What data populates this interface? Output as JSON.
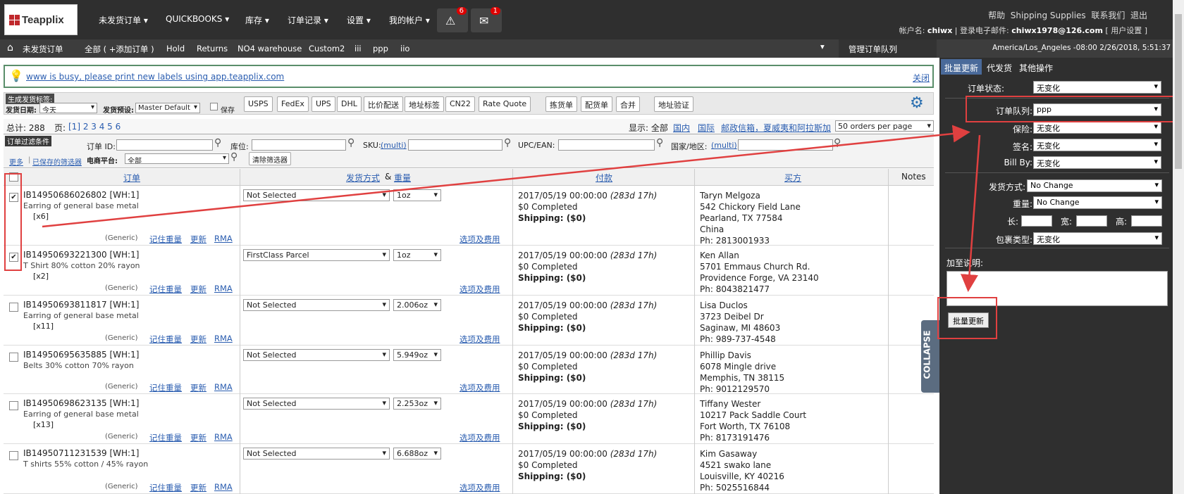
{
  "logo": "Teapplix",
  "topnav": [
    "未发货订单 ▾",
    "QUICKBOOKS ▾",
    "库存 ▾",
    "订单记录 ▾",
    "设置 ▾",
    "我的帐户 ▾"
  ],
  "alerts": {
    "warning_count": "6",
    "message_count": "1"
  },
  "toplinks": {
    "help": "帮助",
    "shipping_supplies": "Shipping Supplies",
    "contact": "联系我们",
    "logout": "退出",
    "account_label": "帐户名:",
    "account": "chiwx",
    "email_label": "登录电子邮件:",
    "email": "chiwx1978@126.com",
    "user_settings": "[ 用户设置 ]"
  },
  "navbar": {
    "home": "未发货订单",
    "items": [
      "全部 ( +添加订单 )",
      "Hold",
      "Returns",
      "NO4 warehouse",
      "Custom2",
      "iii",
      "ppp",
      "iio"
    ],
    "manage_queue": "管理订单队列",
    "timezone": "America/Los_Angeles -08:00 2/26/2018, 5:51:37 PM"
  },
  "notice": {
    "text": "www is busy, please print new labels using app.teapplix.com",
    "close": "关闭"
  },
  "toolbar": {
    "title": "生成发货标签:",
    "date_label": "发货日期:",
    "date_value": "今天",
    "preset_label": "发货预设:",
    "preset_value": "Master Default",
    "save_label": "保存",
    "buttons": [
      "USPS",
      "FedEx",
      "UPS",
      "DHL",
      "比价配送",
      "地址标签",
      "CN22",
      "Rate Quote"
    ],
    "buttons2": [
      "拣货单",
      "配货单",
      "合并"
    ],
    "verify": "地址验证"
  },
  "summary": {
    "total": "总计: 288",
    "pages_label": "页:",
    "pages": "[1] 2 3 4 5 6",
    "show_label": "显示: 全部",
    "domestic": "国内",
    "intl": "国际",
    "postal": "邮政信箱，夏威夷和阿拉斯加",
    "per_page": "50 orders per page"
  },
  "filters": {
    "title": "订单过滤条件",
    "order_id": "订单 ID:",
    "warehouse": "库位:",
    "sku": "SKU:",
    "multi": "(multi)",
    "upc": "UPC/EAN:",
    "country": "国家/地区:",
    "more": "更多",
    "saved": "已保存的筛选器",
    "platform": "电商平台:",
    "platform_value": "全部",
    "clear": "清除筛选器"
  },
  "columns": {
    "order": "订单",
    "ship_method": "发货方式",
    "amp": "&",
    "weight": "重量",
    "payment": "付款",
    "buyer": "买方",
    "notes": "Notes"
  },
  "row_links": {
    "generic": "(Generic)",
    "remember": "记住重量",
    "update": "更新",
    "rma": "RMA",
    "options": "选项及费用"
  },
  "orders": [
    {
      "id": "IB14950686026802  [WH:1]",
      "desc": "Earring of general base metal",
      "qty": "[x6]",
      "checked": true,
      "ship": "Not Selected",
      "weight": "1oz",
      "date": "2017/05/19 00:00:00",
      "ago": "(283d 17h)",
      "amount": "$0 Completed",
      "shipping": "Shipping: ($0)",
      "buyer": [
        "Taryn Melgoza",
        "542 Chickory Field Lane",
        "Pearland, TX 77584",
        "China",
        "Ph: 2813001933"
      ]
    },
    {
      "id": "IB14950693221300  [WH:1]",
      "desc": "T Shirt 80% cotton 20% rayon",
      "qty": "[x2]",
      "checked": true,
      "ship": "FirstClass Parcel",
      "weight": "1oz",
      "date": "2017/05/19 00:00:00",
      "ago": "(283d 17h)",
      "amount": "$0 Completed",
      "shipping": "Shipping: ($0)",
      "buyer": [
        "Ken Allan",
        "5701 Emmaus Church Rd.",
        "Providence Forge, VA 23140",
        "Ph: 8043821477"
      ]
    },
    {
      "id": "IB14950693811817  [WH:1]",
      "desc": "Earring of general base metal",
      "qty": "[x11]",
      "checked": false,
      "ship": "Not Selected",
      "weight": "2.006oz",
      "date": "2017/05/19 00:00:00",
      "ago": "(283d 17h)",
      "amount": "$0 Completed",
      "shipping": "Shipping: ($0)",
      "buyer": [
        "Lisa Duclos",
        "3723 Deibel Dr",
        "Saginaw, MI 48603",
        "Ph: 989-737-4548"
      ]
    },
    {
      "id": "IB14950695635885  [WH:1]",
      "desc": "Belts 30% cotton 70% rayon",
      "qty": "",
      "checked": false,
      "ship": "Not Selected",
      "weight": "5.949oz",
      "date": "2017/05/19 00:00:00",
      "ago": "(283d 17h)",
      "amount": "$0 Completed",
      "shipping": "Shipping: ($0)",
      "buyer": [
        "Phillip Davis",
        "6078 Mingle drive",
        "Memphis, TN 38115",
        "Ph: 9012129570"
      ]
    },
    {
      "id": "IB14950698623135  [WH:1]",
      "desc": "Earring of general base metal",
      "qty": "[x13]",
      "checked": false,
      "ship": "Not Selected",
      "weight": "2.253oz",
      "date": "2017/05/19 00:00:00",
      "ago": "(283d 17h)",
      "amount": "$0 Completed",
      "shipping": "Shipping: ($0)",
      "buyer": [
        "Tiffany Wester",
        "10217 Pack Saddle Court",
        "Fort Worth, TX 76108",
        "Ph: 8173191476"
      ]
    },
    {
      "id": "IB14950711231539  [WH:1]",
      "desc": "T shirts 55% cotton / 45% rayon",
      "qty": "",
      "checked": false,
      "ship": "Not Selected",
      "weight": "6.688oz",
      "date": "2017/05/19 00:00:00",
      "ago": "(283d 17h)",
      "amount": "$0 Completed",
      "shipping": "Shipping: ($0)",
      "buyer": [
        "Kim Gasaway",
        "4521 swako lane",
        "Louisville, KY 40216",
        "Ph: 5025516844"
      ]
    }
  ],
  "collapse": "COLLAPSE",
  "panel": {
    "tabs": [
      "批量更新",
      "代发货",
      "其他操作"
    ],
    "status_label": "订单状态:",
    "status_value": "无变化",
    "queue_label": "订单队列:",
    "queue_value": "ppp",
    "insurance_label": "保险:",
    "insurance_value": "无变化",
    "signature_label": "签名:",
    "signature_value": "无变化",
    "billby_label": "Bill By:",
    "billby_value": "无变化",
    "ship_label": "发货方式:",
    "ship_value": "No Change",
    "weight_label": "重量:",
    "weight_value": "No Change",
    "length_label": "长:",
    "width_label": "宽:",
    "height_label": "高:",
    "package_label": "包裹类型:",
    "package_value": "无变化",
    "note_label": "加至说明:",
    "submit": "批量更新"
  }
}
